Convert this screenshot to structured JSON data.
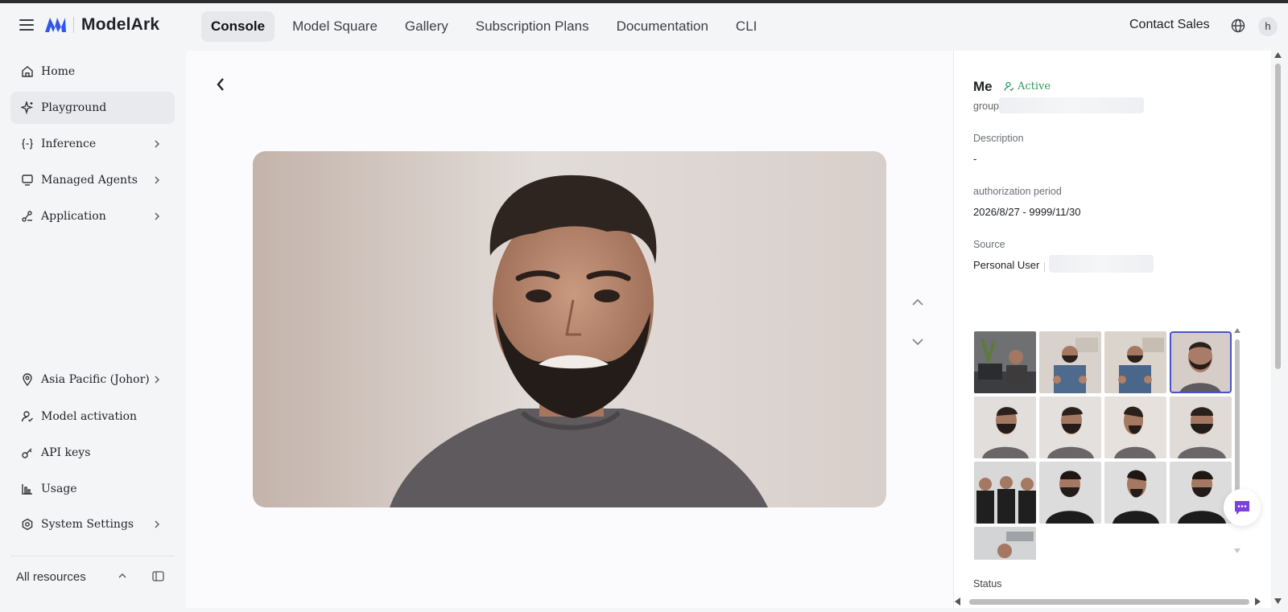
{
  "app": {
    "brand": "ModelArk",
    "accent": "#4a52c8"
  },
  "topnav": {
    "tabs": [
      "Console",
      "Model Square",
      "Gallery",
      "Subscription Plans",
      "Documentation",
      "CLI"
    ],
    "active_tab": "Console",
    "contact": "Contact Sales",
    "avatar_initial": "h"
  },
  "sidebar": {
    "items": [
      {
        "label": "Home",
        "icon": "home-icon",
        "expandable": false
      },
      {
        "label": "Playground",
        "icon": "sparkle-icon",
        "expandable": false,
        "active": true
      },
      {
        "label": "Inference",
        "icon": "code-braces-icon",
        "expandable": true
      },
      {
        "label": "Managed Agents",
        "icon": "agent-monitor-icon",
        "expandable": true
      },
      {
        "label": "Application",
        "icon": "app-nodes-icon",
        "expandable": true
      }
    ],
    "bottom_items": [
      {
        "label": "Asia Pacific (Johor)",
        "icon": "location-icon",
        "expandable": true
      },
      {
        "label": "Model activation",
        "icon": "user-activation-icon",
        "expandable": false
      },
      {
        "label": "API keys",
        "icon": "key-icon",
        "expandable": false
      },
      {
        "label": "Usage",
        "icon": "bar-chart-icon",
        "expandable": false
      },
      {
        "label": "System Settings",
        "icon": "settings-icon",
        "expandable": true
      }
    ],
    "footer": "All resources"
  },
  "detail": {
    "name": "Me",
    "status": "Active",
    "status_color": "#2e9a5a",
    "group_id_label": "group ID:",
    "description_label": "Description",
    "description_value": "-",
    "auth_label": "authorization period",
    "auth_value": "2026/8/27 - 9999/11/30",
    "source_label": "Source",
    "source_value": "Personal User",
    "status_label": "Status",
    "thumbnail_count": 13,
    "selected_thumbnail": 4
  }
}
